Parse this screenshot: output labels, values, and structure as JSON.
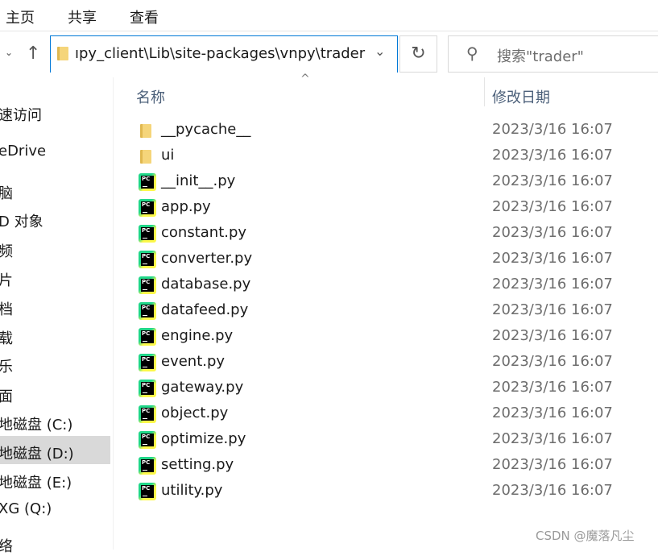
{
  "ribbon": {
    "tabs": [
      "主页",
      "共享",
      "查看"
    ]
  },
  "address": {
    "path": "ıpy_client\\Lib\\site-packages\\vnpy\\trader"
  },
  "search": {
    "placeholder": "搜索\"trader\""
  },
  "columns": {
    "name": "名称",
    "modified": "修改日期"
  },
  "nav": {
    "items": [
      {
        "label": "速访问"
      },
      {
        "label": "eDrive"
      },
      {
        "label": "脑"
      },
      {
        "label": "D 对象"
      },
      {
        "label": "频"
      },
      {
        "label": "片"
      },
      {
        "label": "档"
      },
      {
        "label": "载"
      },
      {
        "label": "乐"
      },
      {
        "label": "面"
      },
      {
        "label": "地磁盘 (C:)"
      },
      {
        "label": "地磁盘 (D:)",
        "selected": true
      },
      {
        "label": "地磁盘 (E:)"
      },
      {
        "label": "XG (Q:)"
      },
      {
        "label": "络"
      }
    ]
  },
  "files": [
    {
      "name": "__pycache__",
      "type": "folder",
      "modified": "2023/3/16 16:07"
    },
    {
      "name": "ui",
      "type": "folder",
      "modified": "2023/3/16 16:07"
    },
    {
      "name": "__init__.py",
      "type": "py",
      "modified": "2023/3/16 16:07"
    },
    {
      "name": "app.py",
      "type": "py",
      "modified": "2023/3/16 16:07"
    },
    {
      "name": "constant.py",
      "type": "py",
      "modified": "2023/3/16 16:07"
    },
    {
      "name": "converter.py",
      "type": "py",
      "modified": "2023/3/16 16:07"
    },
    {
      "name": "database.py",
      "type": "py",
      "modified": "2023/3/16 16:07"
    },
    {
      "name": "datafeed.py",
      "type": "py",
      "modified": "2023/3/16 16:07"
    },
    {
      "name": "engine.py",
      "type": "py",
      "modified": "2023/3/16 16:07"
    },
    {
      "name": "event.py",
      "type": "py",
      "modified": "2023/3/16 16:07"
    },
    {
      "name": "gateway.py",
      "type": "py",
      "modified": "2023/3/16 16:07"
    },
    {
      "name": "object.py",
      "type": "py",
      "modified": "2023/3/16 16:07"
    },
    {
      "name": "optimize.py",
      "type": "py",
      "modified": "2023/3/16 16:07"
    },
    {
      "name": "setting.py",
      "type": "py",
      "modified": "2023/3/16 16:07"
    },
    {
      "name": "utility.py",
      "type": "py",
      "modified": "2023/3/16 16:07"
    }
  ],
  "watermark": "CSDN @魔落凡尘",
  "colors": {
    "accent": "#0078d7",
    "selected": "#d9d9d9"
  }
}
